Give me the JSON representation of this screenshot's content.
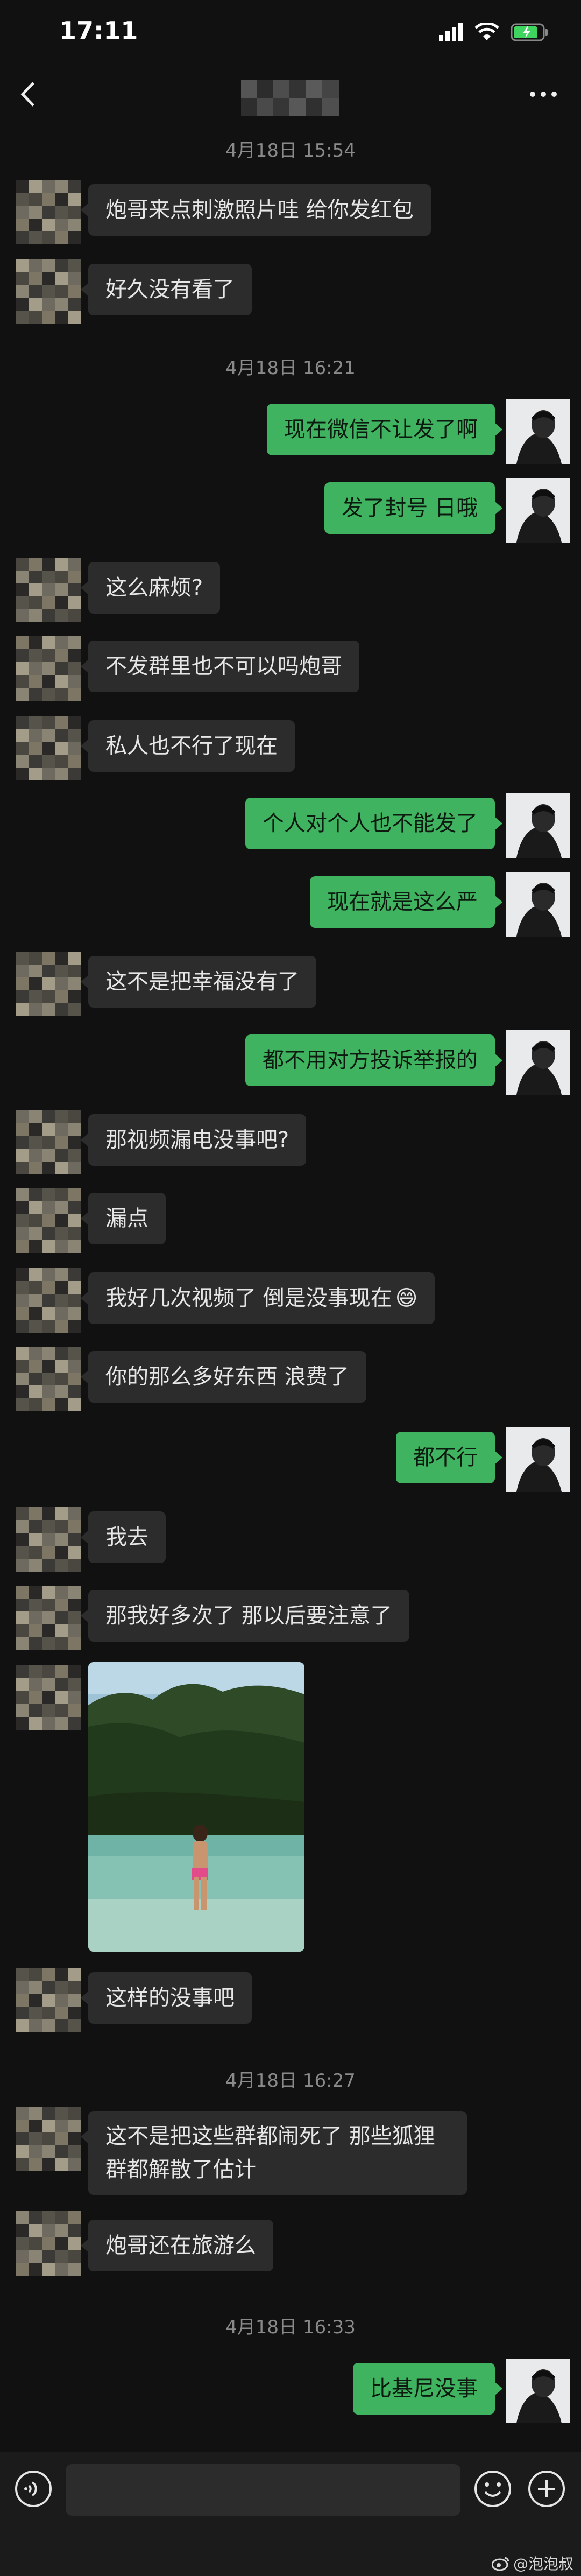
{
  "status_bar": {
    "time": "17:11"
  },
  "nav": {
    "title": ""
  },
  "timestamps": [
    "4月18日 15:54",
    "4月18日 16:21",
    "4月18日 16:27",
    "4月18日 16:33"
  ],
  "messages": [
    {
      "side": "recv",
      "text": "炮哥来点刺激照片哇 给你发红包"
    },
    {
      "side": "recv",
      "text": "好久没有看了"
    },
    {
      "side": "sent",
      "text": "现在微信不让发了啊"
    },
    {
      "side": "sent",
      "text": "发了封号 日哦"
    },
    {
      "side": "recv",
      "text": "这么麻烦?"
    },
    {
      "side": "recv",
      "text": "不发群里也不可以吗炮哥"
    },
    {
      "side": "recv",
      "text": "私人也不行了现在"
    },
    {
      "side": "sent",
      "text": "个人对个人也不能发了"
    },
    {
      "side": "sent",
      "text": "现在就是这么严"
    },
    {
      "side": "recv",
      "text": "这不是把幸福没有了"
    },
    {
      "side": "sent",
      "text": "都不用对方投诉举报的"
    },
    {
      "side": "recv",
      "text": "那视频漏电没事吧?"
    },
    {
      "side": "recv",
      "text": "漏点"
    },
    {
      "side": "recv",
      "text": "我好几次视频了 倒是没事现在"
    },
    {
      "side": "recv",
      "text": "你的那么多好东西 浪费了"
    },
    {
      "side": "sent",
      "text": "都不行"
    },
    {
      "side": "recv",
      "text": "我去"
    },
    {
      "side": "recv",
      "text": "那我好多次了 那以后要注意了"
    },
    {
      "side": "recv",
      "text": "这样的没事吧"
    },
    {
      "side": "recv",
      "text": "这不是把这些群都闹死了 那些狐狸群都解散了估计"
    },
    {
      "side": "recv",
      "text": "炮哥还在旅游么"
    },
    {
      "side": "sent",
      "text": "比基尼没事"
    }
  ],
  "emoji": "😄",
  "input": {
    "placeholder": ""
  },
  "watermark": "@泡泡叔",
  "colors": {
    "background": "#111111",
    "sent_bubble": "#3fb35f",
    "recv_bubble": "#2c2c2c"
  }
}
